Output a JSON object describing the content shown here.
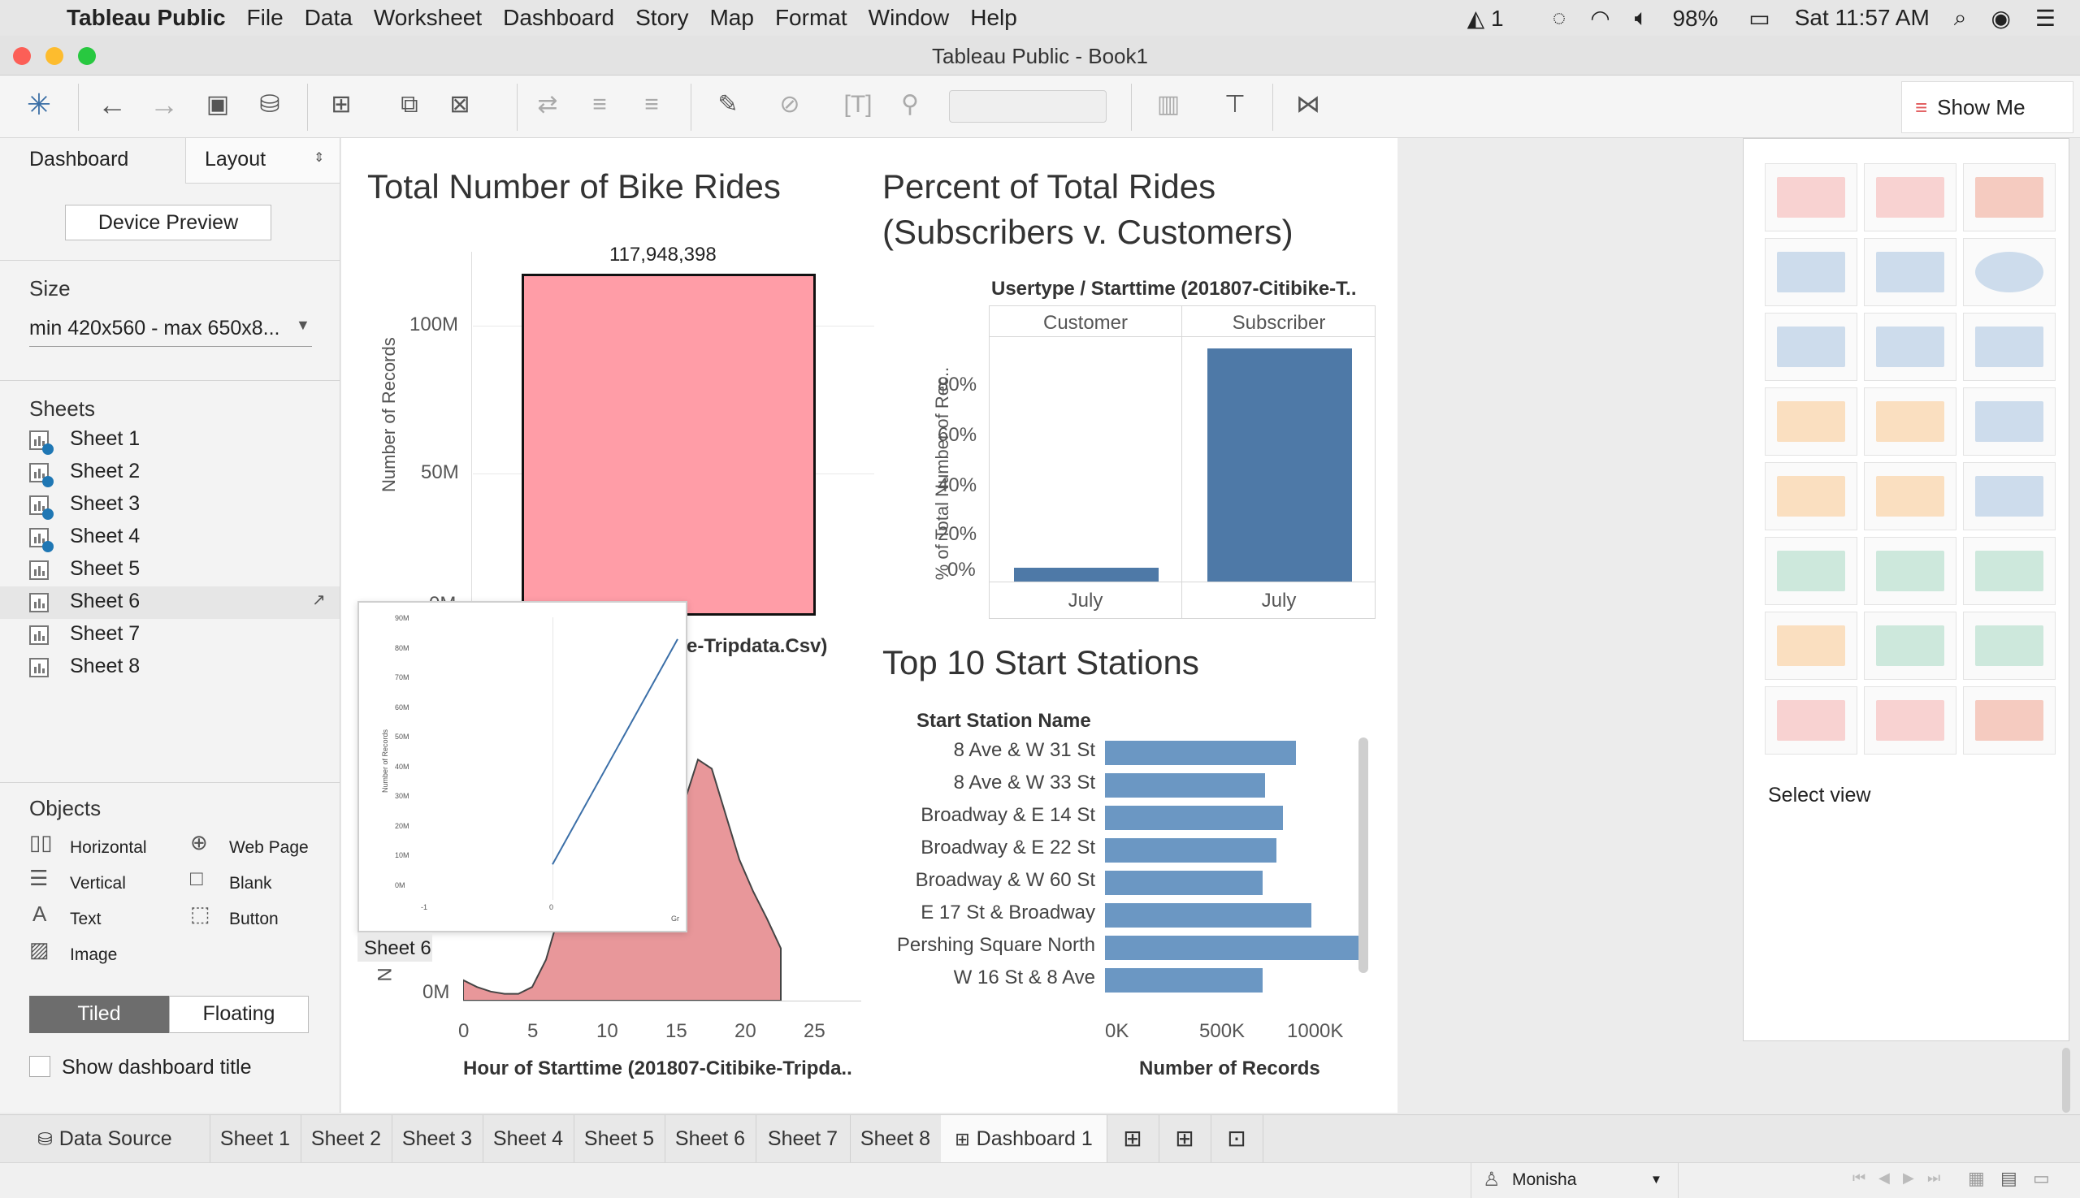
{
  "menubar": {
    "app_name": "Tableau Public",
    "items": [
      "File",
      "Data",
      "Worksheet",
      "Dashboard",
      "Story",
      "Map",
      "Format",
      "Window",
      "Help"
    ],
    "status": {
      "notifications": "1",
      "battery": "98%",
      "clock": "Sat 11:57 AM"
    }
  },
  "window": {
    "title": "Tableau Public - Book1"
  },
  "toolbar": {
    "show_me_label": "Show Me"
  },
  "left_panel": {
    "tab_dashboard": "Dashboard",
    "tab_layout": "Layout",
    "device_preview_label": "Device Preview",
    "size_header": "Size",
    "size_value": "min 420x560 - max 650x8...",
    "sheets_header": "Sheets",
    "sheets": [
      {
        "label": "Sheet 1",
        "used": true
      },
      {
        "label": "Sheet 2",
        "used": true
      },
      {
        "label": "Sheet 3",
        "used": true
      },
      {
        "label": "Sheet 4",
        "used": true
      },
      {
        "label": "Sheet 5",
        "used": false
      },
      {
        "label": "Sheet 6",
        "used": false
      },
      {
        "label": "Sheet 7",
        "used": false
      },
      {
        "label": "Sheet 8",
        "used": false
      }
    ],
    "objects_header": "Objects",
    "objects": {
      "horizontal": "Horizontal",
      "web_page": "Web Page",
      "vertical": "Vertical",
      "blank": "Blank",
      "text": "Text",
      "button": "Button",
      "image": "Image"
    },
    "tiled_label": "Tiled",
    "floating_label": "Floating",
    "show_title_label": "Show dashboard title"
  },
  "dashboard": {
    "chart1": {
      "title": "Total Number of Bike Rides",
      "ylabel": "Number of Records",
      "bar_label": "117,948,398",
      "yticks": [
        "100M",
        "50M",
        "0M"
      ],
      "hidden_title_fragment": "e-Tripdata.Csv)"
    },
    "chart2": {
      "title_line1": "Percent of Total Rides",
      "title_line2": "(Subscribers v. Customers)",
      "header": "Usertype / Starttime (201807-Citibike-T..",
      "col1": "Customer",
      "col2": "Subscriber",
      "ylabel": "% of Total Number of Rec..",
      "yticks": [
        "80%",
        "60%",
        "40%",
        "20%",
        "0%"
      ],
      "x1": "July",
      "x2": "July"
    },
    "chart3": {
      "title": "Top 10 Start Stations",
      "col_header": "Start Station Name",
      "xticks": [
        "0K",
        "500K",
        "1000K"
      ],
      "xlabel": "Number of Records"
    },
    "chart4": {
      "yticks_visible": [
        "0M"
      ],
      "xticks": [
        "0",
        "5",
        "10",
        "15",
        "20",
        "25"
      ],
      "xlabel": "Hour of Starttime (201807-Citibike-Tripda..",
      "ylabel_fragment": "N"
    },
    "drag_preview": {
      "label": "Sheet 6",
      "yticks": [
        "90M",
        "80M",
        "70M",
        "60M",
        "50M",
        "40M",
        "30M",
        "20M",
        "10M",
        "0M"
      ],
      "ylabel": "Number of Records",
      "xticks": [
        "-1",
        "0"
      ],
      "corner": "Gr"
    }
  },
  "chart_data": [
    {
      "type": "bar",
      "title": "Total Number of Bike Rides",
      "ylabel": "Number of Records",
      "categories": [
        ""
      ],
      "values": [
        117948398
      ],
      "ylim": [
        0,
        120000000
      ],
      "color": "#ff9da7"
    },
    {
      "type": "bar",
      "title": "Percent of Total Rides (Subscribers v. Customers)",
      "ylabel": "% of Total Number of Rec..",
      "categories": [
        "Customer July",
        "Subscriber July"
      ],
      "values": [
        5.5,
        94.5
      ],
      "ylim": [
        0,
        100
      ],
      "color": "#4e79a7"
    },
    {
      "type": "bar",
      "title": "Top 10 Start Stations",
      "xlabel": "Number of Records",
      "categories": [
        "8 Ave & W 31 St",
        "8 Ave & W 33 St",
        "Broadway & E 14 St",
        "Broadway & E 22 St",
        "Broadway & W 60 St",
        "E 17 St & Broadway",
        "Pershing Square North",
        "W 16 St & 8 Ave"
      ],
      "values": [
        870000,
        730000,
        810000,
        780000,
        720000,
        940000,
        1170000,
        720000
      ],
      "xlim": [
        0,
        1200000
      ],
      "color": "#6b97c3"
    },
    {
      "type": "area",
      "xlabel": "Hour of Starttime (201807-Citibike-Tripda..",
      "x": [
        0,
        1,
        2,
        3,
        4,
        5,
        6,
        7,
        8,
        9,
        10,
        11,
        12,
        13,
        14,
        15,
        16,
        17,
        18,
        19,
        20,
        21,
        22,
        23
      ],
      "values": [
        0.9,
        0.6,
        0.4,
        0.3,
        0.3,
        0.6,
        1.8,
        3.9,
        6.3,
        5.6,
        4.9,
        5.1,
        5.6,
        6.0,
        6.5,
        7.2,
        8.7,
        10.6,
        10.2,
        8.2,
        6.2,
        4.8,
        3.6,
        2.3
      ],
      "color": "#e8979a"
    },
    {
      "type": "line",
      "ylabel": "Number of Records",
      "x": [
        0,
        1
      ],
      "values": [
        5000000,
        83000000
      ],
      "ylim": [
        0,
        90000000
      ],
      "color": "#3b6fa8"
    }
  ],
  "tabs": {
    "data_source": "Data Source",
    "sheets": [
      "Sheet 1",
      "Sheet 2",
      "Sheet 3",
      "Sheet 4",
      "Sheet 5",
      "Sheet 6",
      "Sheet 7",
      "Sheet 8"
    ],
    "dashboard": "Dashboard 1"
  },
  "status": {
    "user": "Monisha"
  },
  "show_me": {
    "select_view_label": "Select view"
  },
  "colors": {
    "accent_blue": "#4e79a7",
    "bar_pink": "#ff9da7",
    "station_blue": "#6b97c3"
  }
}
